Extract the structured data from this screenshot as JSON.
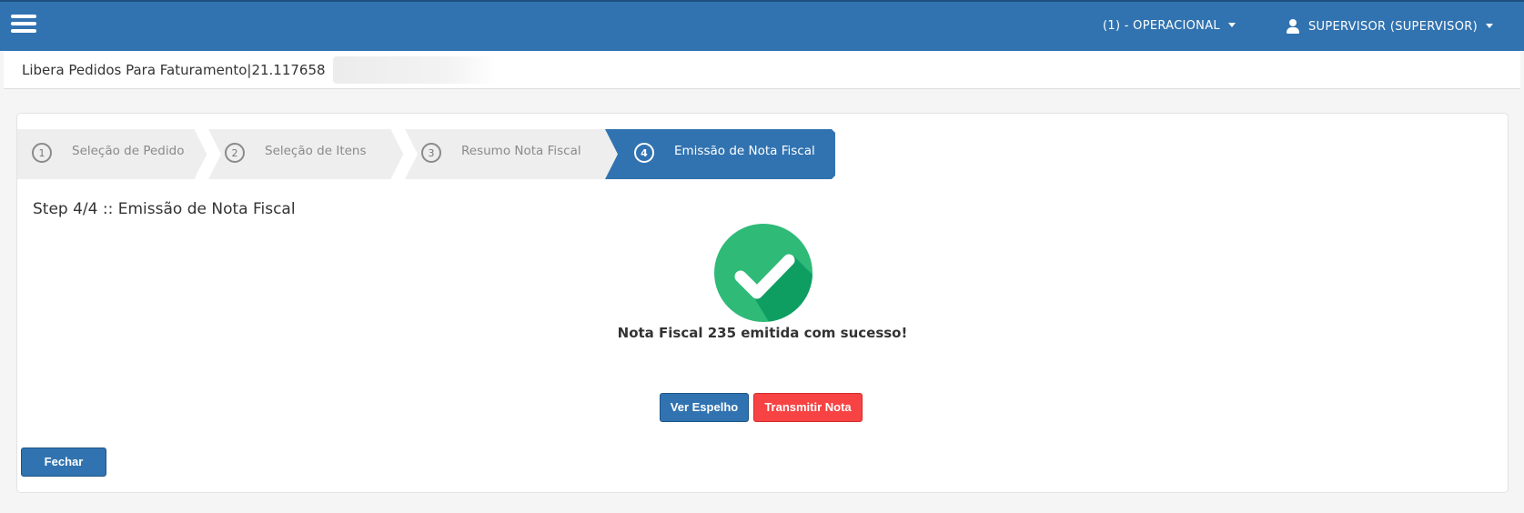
{
  "topbar": {
    "context_menu_label": "(1) - OPERACIONAL",
    "user_menu_label": "SUPERVISOR (SUPERVISOR)"
  },
  "page": {
    "title": "Libera Pedidos Para Faturamento|21.117658"
  },
  "wizard": {
    "steps": [
      {
        "number": "1",
        "label": "Seleção de Pedido"
      },
      {
        "number": "2",
        "label": "Seleção de Itens"
      },
      {
        "number": "3",
        "label": "Resumo Nota Fiscal"
      },
      {
        "number": "4",
        "label": "Emissão de Nota Fiscal"
      }
    ],
    "active_step": 4
  },
  "content": {
    "heading": "Step 4/4 :: Emissão de Nota Fiscal",
    "success_message": "Nota Fiscal 235 emitida com sucesso!",
    "view_mirror_label": "Ver Espelho",
    "transmit_label": "Transmitir Nota",
    "close_label": "Fechar"
  },
  "colors": {
    "topbar": "#3173b0",
    "step_inactive": "#eeeeee",
    "step_active": "#3173b0",
    "success_green": "#2fba78",
    "danger_red": "#f74343"
  },
  "icons": {
    "menu": "hamburger-menu-icon",
    "user": "user-icon",
    "success": "success-check-icon"
  }
}
